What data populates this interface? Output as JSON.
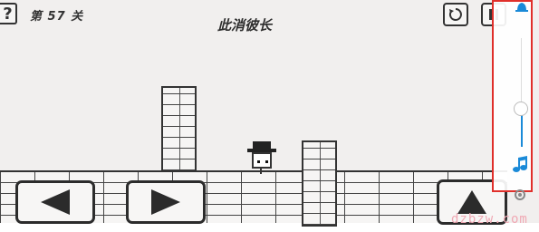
{
  "hud": {
    "help_label": "?",
    "level_label": "第 57 关",
    "level_title": "此消彼长"
  },
  "toolbar": {
    "restart_icon": "restart-icon",
    "pause_icon": "pause-icon"
  },
  "controls": {
    "left_icon": "left-arrow-icon",
    "right_icon": "right-arrow-icon",
    "jump_icon": "up-arrow-icon"
  },
  "side_panel": {
    "bell_icon": "bell-icon",
    "note_icon": "music-note-icon",
    "gear_icon": "gear-icon",
    "volume_level": 0.36,
    "accent_color": "#1a8ad8",
    "highlight_color": "#e0302b"
  },
  "watermark": "dzbzw.com"
}
